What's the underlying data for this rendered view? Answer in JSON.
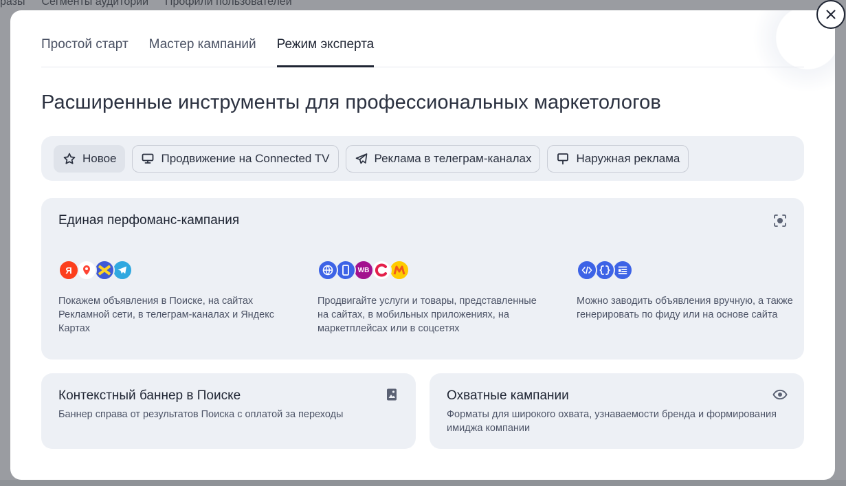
{
  "background": {
    "nav": [
      "разы",
      "Сегменты аудитории",
      "Профили пользователей"
    ]
  },
  "modal": {
    "close_icon": "close-icon",
    "tabs": [
      {
        "label": "Простой старт",
        "active": false
      },
      {
        "label": "Мастер кампаний",
        "active": false
      },
      {
        "label": "Режим эксперта",
        "active": true
      }
    ],
    "headline": "Расширенные инструменты для профессиональных маркетологов",
    "filters": [
      {
        "label": "Новое",
        "icon": "star-icon",
        "selected": true
      },
      {
        "label": "Продвижение на Connected TV",
        "icon": "tv-icon",
        "selected": false
      },
      {
        "label": "Реклама в телеграм-каналах",
        "icon": "telegram-icon",
        "selected": false
      },
      {
        "label": "Наружная реклама",
        "icon": "billboard-icon",
        "selected": false
      }
    ],
    "performance_card": {
      "title": "Единая перфоманс-кампания",
      "icon": "focus-icon",
      "columns": [
        {
          "icons": [
            "yandex-icon",
            "maps-pin-icon",
            "ad-network-icon",
            "telegram-icon"
          ],
          "text": "Покажем объявления в Поиске, на сайтах Рекламной сети, в телеграм-каналах и Яндекс Картах"
        },
        {
          "icons": [
            "globe-icon",
            "mobile-icon",
            "wildberries-icon",
            "megamarket-icon",
            "market-icon"
          ],
          "text": "Продвигайте услуги и товары, представленные на сайтах, в мобильных приложениях, на маркетплейсах или в соцсетях"
        },
        {
          "icons": [
            "code-icon",
            "feed-icon",
            "article-icon"
          ],
          "text": "Можно заводить объявления вручную, а также генерировать по фиду или на основе сайта"
        }
      ]
    },
    "banner_card": {
      "title": "Контекстный баннер в Поиске",
      "desc": "Баннер справа от результатов Поиска с оплатой за переходы",
      "icon": "image-icon"
    },
    "reach_card": {
      "title": "Охватные кампании",
      "desc": "Форматы для широкого охвата, узнаваемости бренда и формирования имиджа компании",
      "icon": "eye-icon"
    },
    "colors": {
      "card_bg": "#edf0f5",
      "text": "#1f2533",
      "muted": "#4c5366"
    }
  }
}
